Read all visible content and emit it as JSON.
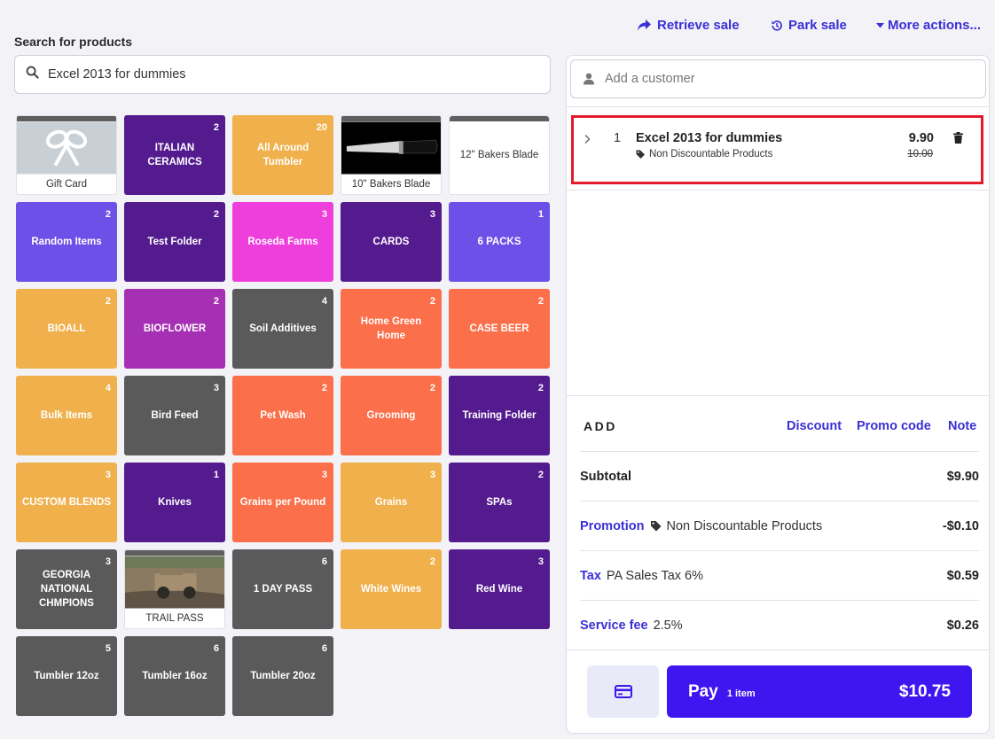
{
  "search": {
    "label": "Search for products",
    "value": "Excel 2013 for dummies",
    "icon": "search-icon"
  },
  "header_actions": {
    "retrieve": "Retrieve sale",
    "park": "Park sale",
    "more": "More actions..."
  },
  "tiles": [
    {
      "label": "Gift Card",
      "count": "",
      "style": "img",
      "image": "ribbon"
    },
    {
      "label": "ITALIAN CERAMICS",
      "count": "2",
      "style": "c-purple"
    },
    {
      "label": "All Around Tumbler",
      "count": "20",
      "style": "c-orange"
    },
    {
      "label": "10\" Bakers Blade",
      "count": "",
      "style": "img",
      "image": "knife"
    },
    {
      "label": "12\" Bakers Blade",
      "count": "",
      "style": "plain"
    },
    {
      "label": "Random Items",
      "count": "2",
      "style": "c-violet"
    },
    {
      "label": "Test Folder",
      "count": "2",
      "style": "c-purple"
    },
    {
      "label": "Roseda Farms",
      "count": "3",
      "style": "c-magenta"
    },
    {
      "label": "CARDS",
      "count": "3",
      "style": "c-purple"
    },
    {
      "label": "6 PACKS",
      "count": "1",
      "style": "c-violet"
    },
    {
      "label": "BIOALL",
      "count": "2",
      "style": "c-orange"
    },
    {
      "label": "BIOFLOWER",
      "count": "2",
      "style": "c-orchid"
    },
    {
      "label": "Soil Additives",
      "count": "4",
      "style": "c-gray"
    },
    {
      "label": "Home Green Home",
      "count": "2",
      "style": "c-coral"
    },
    {
      "label": "CASE BEER",
      "count": "2",
      "style": "c-coral"
    },
    {
      "label": "Bulk Items",
      "count": "4",
      "style": "c-orange"
    },
    {
      "label": "Bird Feed",
      "count": "3",
      "style": "c-gray"
    },
    {
      "label": "Pet Wash",
      "count": "2",
      "style": "c-coral"
    },
    {
      "label": "Grooming",
      "count": "2",
      "style": "c-coral"
    },
    {
      "label": "Training Folder",
      "count": "2",
      "style": "c-purple"
    },
    {
      "label": "CUSTOM BLENDS",
      "count": "3",
      "style": "c-orange"
    },
    {
      "label": "Knives",
      "count": "1",
      "style": "c-purple"
    },
    {
      "label": "Grains per Pound",
      "count": "3",
      "style": "c-coral"
    },
    {
      "label": "Grains",
      "count": "3",
      "style": "c-orange"
    },
    {
      "label": "SPAs",
      "count": "2",
      "style": "c-purple"
    },
    {
      "label": "GEORGIA NATIONAL CHMPIONS",
      "count": "3",
      "style": "c-gray"
    },
    {
      "label": "TRAIL PASS",
      "count": "",
      "style": "img",
      "image": "jeep"
    },
    {
      "label": "1 DAY PASS",
      "count": "6",
      "style": "c-gray"
    },
    {
      "label": "White Wines",
      "count": "2",
      "style": "c-orange"
    },
    {
      "label": "Red Wine",
      "count": "3",
      "style": "c-purple"
    },
    {
      "label": "Tumbler 12oz",
      "count": "5",
      "style": "c-gray"
    },
    {
      "label": "Tumbler 16oz",
      "count": "6",
      "style": "c-gray"
    },
    {
      "label": "Tumbler 20oz",
      "count": "6",
      "style": "c-gray"
    }
  ],
  "cart": {
    "customer_placeholder": "Add a customer",
    "item": {
      "qty": "1",
      "name": "Excel 2013 for dummies",
      "tag": "Non Discountable Products",
      "price": "9.90",
      "original_price": "10.00"
    },
    "add_label": "ADD",
    "add_links": {
      "discount": "Discount",
      "promo": "Promo code",
      "note": "Note"
    },
    "subtotal": {
      "label": "Subtotal",
      "amount": "$9.90"
    },
    "promotion": {
      "label": "Promotion",
      "detail": "Non Discountable Products",
      "amount": "-$0.10"
    },
    "tax": {
      "label": "Tax",
      "detail": "PA Sales Tax 6%",
      "amount": "$0.59"
    },
    "service_fee": {
      "label": "Service fee",
      "detail": "2.5%",
      "amount": "$0.26"
    },
    "pay": {
      "label": "Pay",
      "items": "1 item",
      "amount": "$10.75"
    }
  },
  "colors": {
    "accent": "#3b2fd6",
    "pay_button": "#3f15f0",
    "highlight_border": "#e21b2b",
    "purple": "#541b8f",
    "orange": "#f0b04c",
    "violet": "#6d50e8",
    "magenta": "#ee3fdd",
    "coral": "#fb6f4a",
    "gray": "#5a5a5a",
    "orchid": "#a630b3"
  }
}
